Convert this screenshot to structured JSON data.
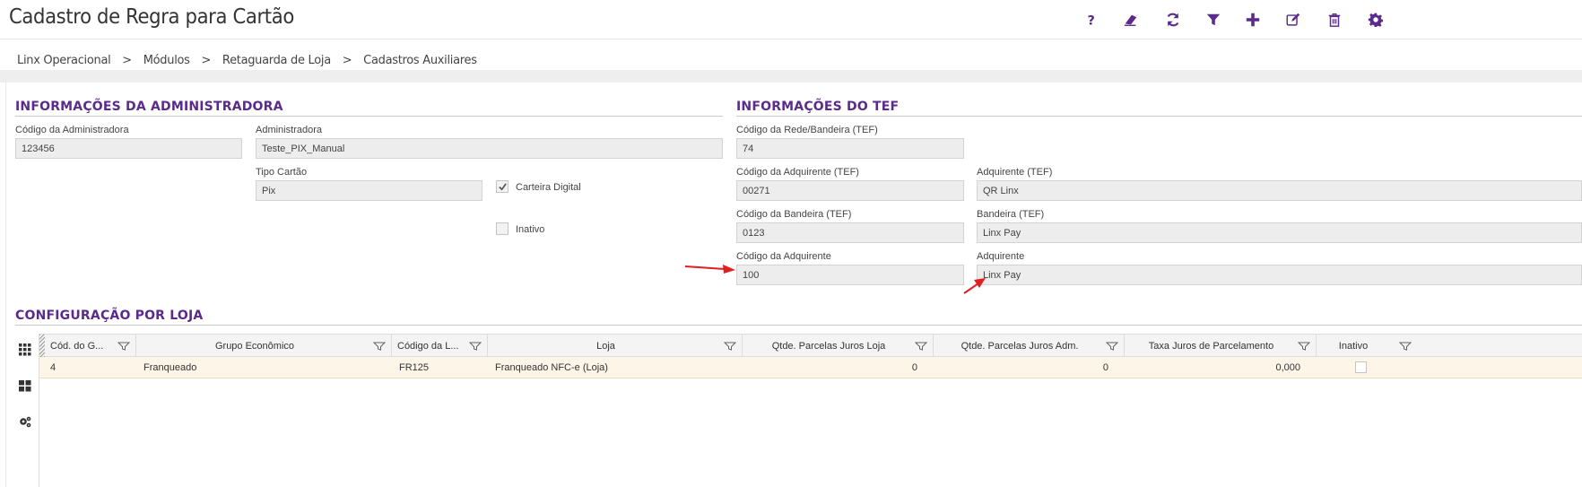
{
  "header": {
    "title": "Cadastro de Regra para Cartão",
    "toolbar": [
      {
        "name": "help-icon",
        "label": "?"
      },
      {
        "name": "eraser-icon",
        "label": "clear"
      },
      {
        "name": "refresh-icon",
        "label": "refresh"
      },
      {
        "name": "filter-icon",
        "label": "filter"
      },
      {
        "name": "plus-icon",
        "label": "add"
      },
      {
        "name": "edit-icon",
        "label": "edit"
      },
      {
        "name": "trash-icon",
        "label": "delete"
      },
      {
        "name": "gear-icon",
        "label": "settings"
      }
    ],
    "accent_color": "#5b2b8c"
  },
  "breadcrumb": [
    "Linx Operacional",
    "Módulos",
    "Retaguarda de Loja",
    "Cadastros Auxiliares"
  ],
  "breadcrumb_sep": ">",
  "admin_section": {
    "title": "INFORMAÇÕES DA ADMINISTRADORA",
    "codigo_label": "Código da Administradora",
    "codigo_value": "123456",
    "admin_label": "Administradora",
    "admin_value": "Teste_PIX_Manual",
    "tipo_label": "Tipo Cartão",
    "tipo_value": "Pix",
    "carteira_label": "Carteira Digital",
    "carteira_checked": true,
    "inativo_label": "Inativo",
    "inativo_checked": false
  },
  "tef_section": {
    "title": "INFORMAÇÕES DO TEF",
    "rede_label": "Código da Rede/Bandeira (TEF)",
    "rede_value": "74",
    "cod_adq_tef_label": "Código da Adquirente (TEF)",
    "cod_adq_tef_value": "00271",
    "adq_tef_label": "Adquirente (TEF)",
    "adq_tef_value": "QR Linx",
    "cod_band_tef_label": "Código da Bandeira (TEF)",
    "cod_band_tef_value": "0123",
    "band_tef_label": "Bandeira (TEF)",
    "band_tef_value": "Linx Pay",
    "cod_adq_label": "Código da Adquirente",
    "cod_adq_value": "100",
    "adq_label": "Adquirente",
    "adq_value": "Linx Pay",
    "annotation_color": "#e02020"
  },
  "loja_section": {
    "title": "CONFIGURAÇÃO POR LOJA",
    "columns": [
      "Cód. do G...",
      "Grupo Econômico",
      "Código da L...",
      "Loja",
      "Qtde. Parcelas Juros Loja",
      "Qtde. Parcelas Juros Adm.",
      "Taxa Juros de Parcelamento",
      "Inativo"
    ],
    "rows": [
      {
        "cod_grupo": "4",
        "grupo": "Franqueado",
        "cod_loja": "FR125",
        "loja": "Franqueado NFC-e (Loja)",
        "parc_loja": "0",
        "parc_adm": "0",
        "taxa": "0,000",
        "inativo": false
      }
    ],
    "row_highlight_color": "#fdf5e8"
  }
}
